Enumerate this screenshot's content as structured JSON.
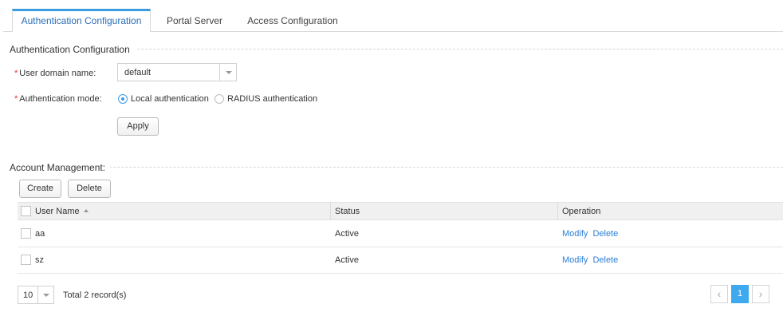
{
  "tabs": [
    {
      "label": "Authentication Configuration",
      "active": true
    },
    {
      "label": "Portal Server",
      "active": false
    },
    {
      "label": "Access Configuration",
      "active": false
    }
  ],
  "auth": {
    "section_title": "Authentication Configuration",
    "required_mark": "*",
    "domain_label": "User domain name:",
    "domain_value": "default",
    "mode_label": "Authentication mode:",
    "mode_options": [
      {
        "label": "Local authentication",
        "selected": true
      },
      {
        "label": "RADIUS authentication",
        "selected": false
      }
    ],
    "apply_label": "Apply"
  },
  "accounts": {
    "section_title": "Account Management:",
    "create_label": "Create",
    "delete_label": "Delete",
    "columns": [
      "User Name",
      "Status",
      "Operation"
    ],
    "rows": [
      {
        "user": "aa",
        "status": "Active",
        "op_modify": "Modify",
        "op_delete": "Delete"
      },
      {
        "user": "sz",
        "status": "Active",
        "op_modify": "Modify",
        "op_delete": "Delete"
      }
    ],
    "page_size": "10",
    "total_text": "Total 2 record(s)",
    "current_page": "1"
  },
  "colors": {
    "accent": "#3d9be0",
    "link": "#2b7fd6",
    "required": "#ee3333"
  }
}
